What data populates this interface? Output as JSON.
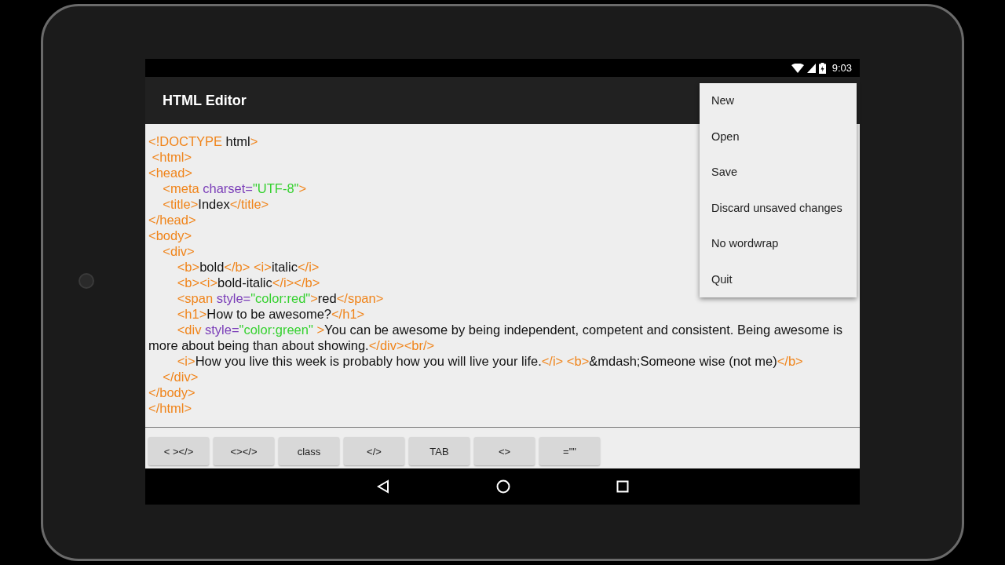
{
  "status_bar": {
    "time": "9:03"
  },
  "app_bar": {
    "title": "HTML Editor"
  },
  "editor": {
    "lines": [
      [
        {
          "kind": "tag",
          "text": "<!DOCTYPE "
        },
        {
          "kind": "text",
          "text": "html"
        },
        {
          "kind": "tag",
          "text": ">"
        }
      ],
      [
        {
          "kind": "tag",
          "text": " <html>"
        }
      ],
      [
        {
          "kind": "tag",
          "text": "<head>"
        }
      ],
      [
        {
          "kind": "tag",
          "text": "    <meta "
        },
        {
          "kind": "attr",
          "text": "charset="
        },
        {
          "kind": "value",
          "text": "\"UTF-8\""
        },
        {
          "kind": "tag",
          "text": ">"
        }
      ],
      [
        {
          "kind": "tag",
          "text": "    <title>"
        },
        {
          "kind": "text",
          "text": "Index"
        },
        {
          "kind": "tag",
          "text": "</title>"
        }
      ],
      [
        {
          "kind": "tag",
          "text": "</head>"
        }
      ],
      [
        {
          "kind": "tag",
          "text": "<body>"
        }
      ],
      [
        {
          "kind": "tag",
          "text": "    <div>"
        }
      ],
      [
        {
          "kind": "tag",
          "text": "        <b>"
        },
        {
          "kind": "text",
          "text": "bold"
        },
        {
          "kind": "tag",
          "text": "</b> <i>"
        },
        {
          "kind": "text",
          "text": "italic"
        },
        {
          "kind": "tag",
          "text": "</i>"
        }
      ],
      [
        {
          "kind": "tag",
          "text": "        <b><i>"
        },
        {
          "kind": "text",
          "text": "bold-italic"
        },
        {
          "kind": "tag",
          "text": "</i></b>"
        }
      ],
      [
        {
          "kind": "tag",
          "text": "        <span "
        },
        {
          "kind": "attr",
          "text": "style="
        },
        {
          "kind": "value",
          "text": "\"color:red\""
        },
        {
          "kind": "tag",
          "text": ">"
        },
        {
          "kind": "text",
          "text": "red"
        },
        {
          "kind": "tag",
          "text": "</span>"
        }
      ],
      [
        {
          "kind": "tag",
          "text": "        <h1>"
        },
        {
          "kind": "text",
          "text": "How to be awesome?"
        },
        {
          "kind": "tag",
          "text": "</h1>"
        }
      ],
      [
        {
          "kind": "tag",
          "text": "        <div "
        },
        {
          "kind": "attr",
          "text": "style="
        },
        {
          "kind": "value",
          "text": "\"color:green\""
        },
        {
          "kind": "tag",
          "text": " >"
        },
        {
          "kind": "text",
          "text": "You can be awesome by being independent, competent and consistent. Being awesome is more about being than about showing."
        },
        {
          "kind": "tag",
          "text": "</div><br/>"
        }
      ],
      [
        {
          "kind": "tag",
          "text": "        <i>"
        },
        {
          "kind": "text",
          "text": "How you live this week is probably how you will live your life."
        },
        {
          "kind": "tag",
          "text": "</i> <b>"
        },
        {
          "kind": "text",
          "text": "&mdash;Someone wise (not me)"
        },
        {
          "kind": "tag",
          "text": "</b>"
        }
      ],
      [
        {
          "kind": "tag",
          "text": "    </div>"
        }
      ],
      [
        {
          "kind": "tag",
          "text": "</body>"
        }
      ],
      [
        {
          "kind": "tag",
          "text": "</html>"
        }
      ]
    ]
  },
  "shortcut_buttons": [
    "< ></>",
    "<></>",
    "class",
    "</>",
    "TAB",
    "<>",
    "=\"\""
  ],
  "overflow_menu": {
    "items": [
      "New",
      "Open",
      "Save",
      "Discard unsaved changes",
      "No wordwrap",
      "Quit"
    ]
  }
}
